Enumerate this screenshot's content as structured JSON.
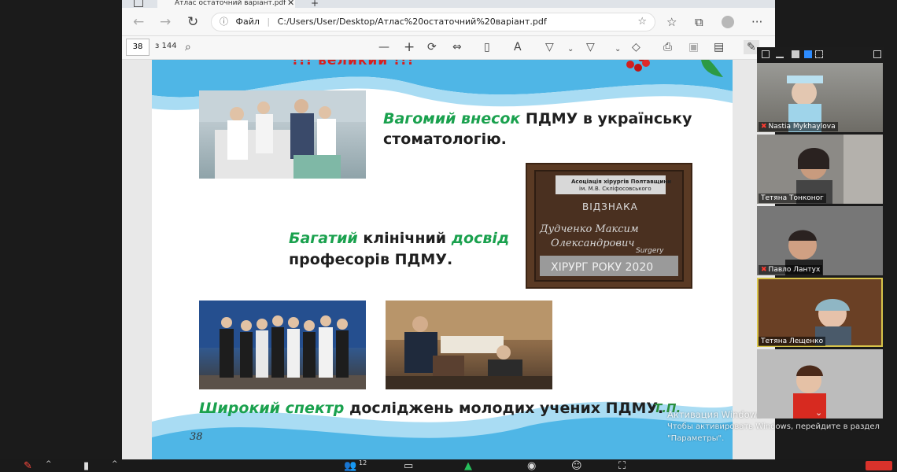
{
  "browser": {
    "tab_title": "Атлас остаточний варіант.pdf",
    "tab_close": "✕",
    "new_tab": "+",
    "address": {
      "info_label": "Файл",
      "url": "C:/Users/User/Desktop/Атлас%20остаточний%20варіант.pdf"
    },
    "nav": {
      "back": "←",
      "forward": "→",
      "refresh": "↻"
    },
    "toolbar_icons": [
      "favorites-star",
      "collections",
      "profile",
      "more"
    ],
    "more_label": "···"
  },
  "pdf_toolbar": {
    "page_current": "38",
    "page_total": "з 144",
    "zoom_out": "—",
    "zoom_in": "+"
  },
  "slide": {
    "header_text": "!!! великий !!!",
    "line1_green": "Вагомий внесок",
    "line1_rest": " ПДМУ в українську",
    "line1_b": "стоматологію.",
    "line2_green1": "Багатий",
    "line2_mid": " клінічний ",
    "line2_green2": "досвід",
    "line2_b": "професорів ПДМУ.",
    "line3_green": "Широкий спектр",
    "line3_rest": " досліджень молодих учених ПДМУ.",
    "page_number": "38",
    "award": {
      "assoc": "Асоціація хірургів Полтавщини",
      "assoc2": "ім. М.В. Скліфосовського",
      "title": "ВІДЗНАКА",
      "name1": "Дудченко Максим",
      "name2": "Олександрович",
      "bottom": "ХІРУРГ РОКУ 2020",
      "badge": "Surgery"
    },
    "logo_text": "Т.П."
  },
  "watermark": {
    "line1": "Активация Windows",
    "line2": "Чтобы активировать Windows, перейдите в раздел",
    "line3": "\"Параметры\"."
  },
  "participants": [
    {
      "name": "Nastia Mykhaylova",
      "muted": true
    },
    {
      "name": "Тетяна Тонконог",
      "muted": false
    },
    {
      "name": "Павло Лантух",
      "muted": true
    },
    {
      "name": "Тетяна Лещенко",
      "muted": false,
      "active": true
    },
    {
      "name": "",
      "muted": false
    }
  ],
  "zoom_controls": {
    "participants_count": "12"
  },
  "colors": {
    "green_accent": "#1aa14e",
    "red_header": "#d81e1e",
    "wave_blue": "#4fb6e6",
    "active_speaker": "#d8c44a"
  }
}
